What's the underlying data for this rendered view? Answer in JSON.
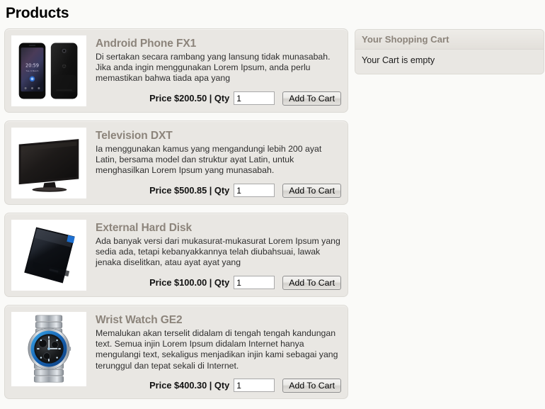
{
  "page": {
    "title": "Products"
  },
  "products": [
    {
      "name": "Android Phone FX1",
      "description": "Di sertakan secara rambang yang lansung tidak munasabah. Jika anda ingin menggunakan Lorem Ipsum, anda perlu memastikan bahwa tiada apa yang",
      "price_label": "Price $200.50 | Qty",
      "price": "$200.50",
      "qty": "1",
      "qty_placeholder": "",
      "button_label": "Add To Cart",
      "image_name": "android-phone-thumbnail"
    },
    {
      "name": "Television DXT",
      "description": "Ia menggunakan kamus yang mengandungi lebih 200 ayat Latin, bersama model dan struktur ayat Latin, untuk menghasilkan Lorem Ipsum yang munasabah.",
      "price_label": "Price $500.85 | Qty",
      "price": "$500.85",
      "qty": "1",
      "qty_placeholder": "",
      "button_label": "Add To Cart",
      "image_name": "television-thumbnail"
    },
    {
      "name": "External Hard Disk",
      "description": "Ada banyak versi dari mukasurat-mukasurat Lorem Ipsum yang sedia ada, tetapi kebanyakkannya telah diubahsuai, lawak jenaka diselitkan, atau ayat ayat yang",
      "price_label": "Price $100.00 | Qty",
      "price": "$100.00",
      "qty": "1",
      "qty_placeholder": "",
      "button_label": "Add To Cart",
      "image_name": "external-hard-disk-thumbnail"
    },
    {
      "name": "Wrist Watch GE2",
      "description": "Memalukan akan terselit didalam di tengah tengah kandungan text. Semua injin Lorem Ipsum didalam Internet hanya mengulangi text, sekaligus menjadikan injin kami sebagai yang terunggul dan tepat sekali di Internet.",
      "price_label": "Price $400.30 | Qty",
      "price": "$400.30",
      "qty": "1",
      "qty_placeholder": "",
      "button_label": "Add To Cart",
      "image_name": "wrist-watch-thumbnail"
    }
  ],
  "cart": {
    "header": "Your Shopping Cart",
    "empty_message": "Your Cart is empty"
  },
  "colors": {
    "page_background": "#fafaf8",
    "card_background": "#e9e7e3",
    "card_border": "#dcdad5",
    "title_text": "#8c847b",
    "body_text": "#2e2e2e",
    "heading_text": "#000000"
  }
}
